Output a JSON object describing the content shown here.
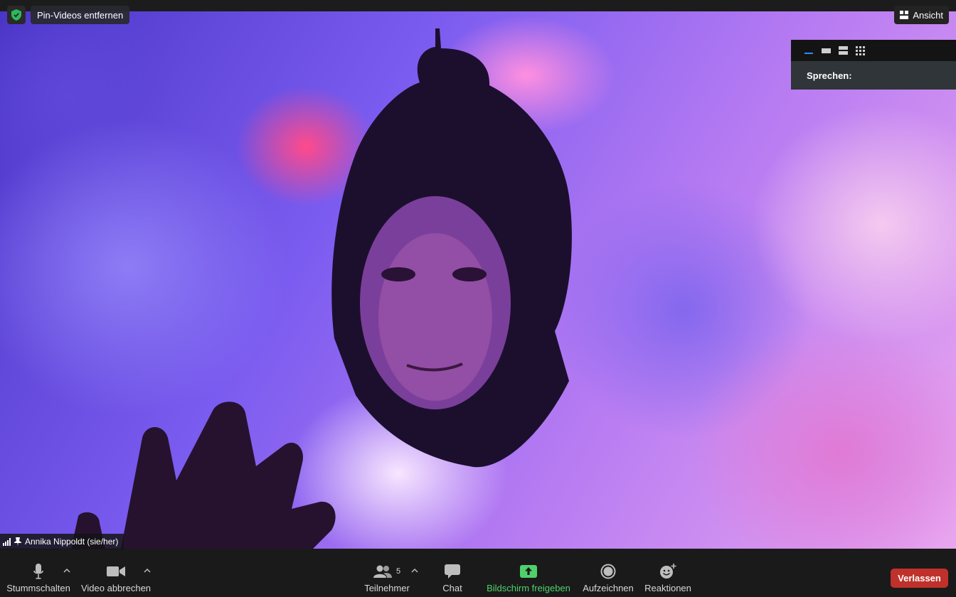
{
  "meeting": {
    "participant_name": "Annika Nippoldt (sie/her)",
    "pin_button_label": "Pin-Videos entfernen",
    "view_button_label": "Ansicht",
    "speaking_label": "Sprechen:"
  },
  "toolbar": {
    "mute_label": "Stummschalten",
    "stop_video_label": "Video abbrechen",
    "participants_label": "Teilnehmer",
    "participants_count": "5",
    "chat_label": "Chat",
    "share_label": "Bildschirm freigeben",
    "record_label": "Aufzeichnen",
    "reactions_label": "Reaktionen",
    "leave_label": "Verlassen"
  },
  "colors": {
    "share_green": "#4fd06b",
    "leave_red": "#c0312b",
    "security_green": "#2eb85c"
  },
  "icons": {
    "security": "shield-check-icon",
    "view": "grid-view-icon",
    "mute": "microphone-icon",
    "video": "video-camera-icon",
    "participants": "people-icon",
    "chat": "chat-bubble-icon",
    "share": "share-screen-icon",
    "record": "record-icon",
    "reactions": "emoji-add-icon",
    "pin": "pin-icon",
    "signal": "signal-bars-icon"
  }
}
